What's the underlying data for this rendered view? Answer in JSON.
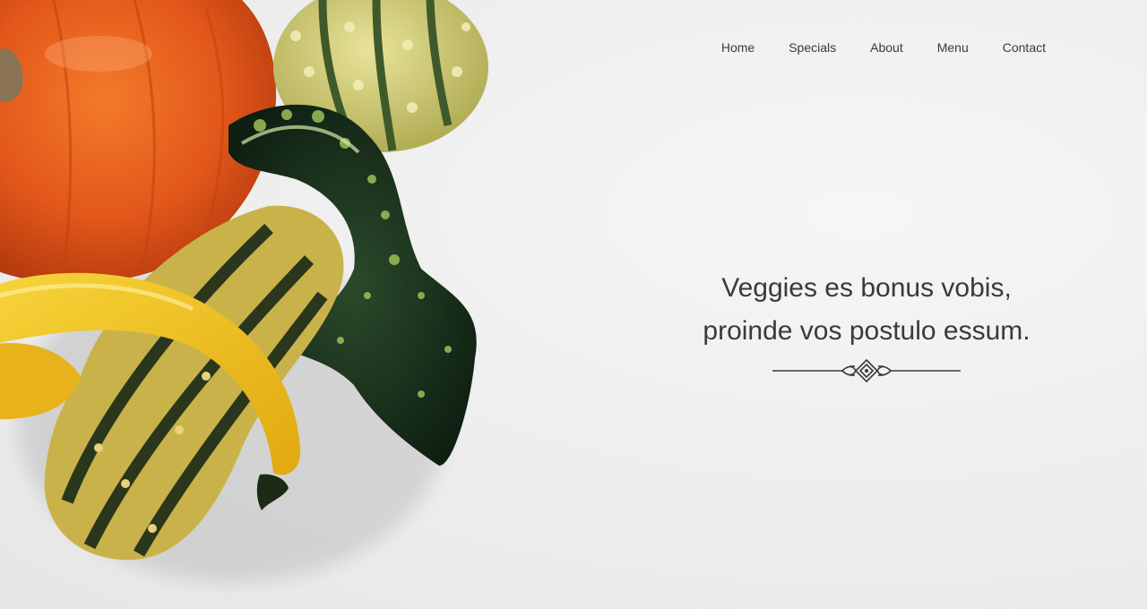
{
  "nav": {
    "items": [
      {
        "label": "Home"
      },
      {
        "label": "Specials"
      },
      {
        "label": "About"
      },
      {
        "label": "Menu"
      },
      {
        "label": "Contact"
      }
    ]
  },
  "hero": {
    "headline_line1": "Veggies es bonus vobis,",
    "headline_line2": "proinde vos postulo essum.",
    "image_subject": "pumpkin-and-gourds-photo",
    "ornament": "divider-ornament-icon"
  },
  "colors": {
    "text": "#3a3a3a",
    "background": "#efefef",
    "pumpkin": "#e2571a",
    "gourd_yellow": "#f0c419",
    "gourd_green": "#1d3a22"
  }
}
